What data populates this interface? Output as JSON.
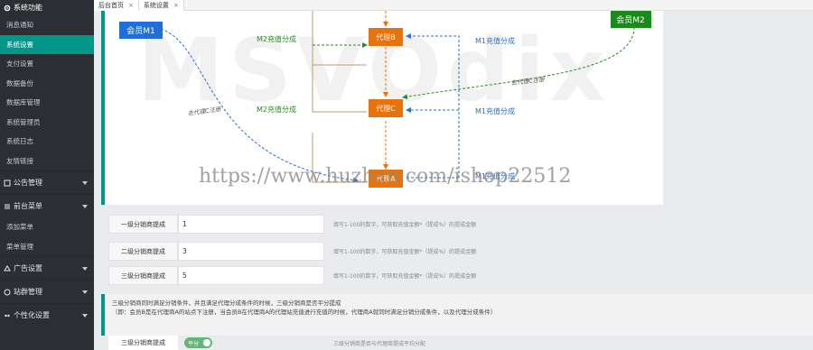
{
  "sidebar": {
    "header": "系统功能",
    "items": [
      {
        "label": "消息通知"
      },
      {
        "label": "系统设置"
      },
      {
        "label": "支付设置"
      },
      {
        "label": "数据备份"
      },
      {
        "label": "数据库管理"
      },
      {
        "label": "系统管理员"
      },
      {
        "label": "系统日志"
      },
      {
        "label": "友情链接"
      }
    ],
    "groups": [
      {
        "label": "公告管理"
      },
      {
        "label": "前台菜单"
      }
    ],
    "group_items": [
      {
        "label": "添加菜单"
      },
      {
        "label": "菜单管理"
      }
    ],
    "groups2": [
      {
        "label": "广告设置"
      },
      {
        "label": "站群管理"
      },
      {
        "label": "个性化设置"
      }
    ]
  },
  "tabs": [
    {
      "label": "后台首页"
    },
    {
      "label": "系统设置"
    }
  ],
  "diagram": {
    "watermark": "MSVOdix",
    "nodes": {
      "member_m1": "会员M1",
      "member_m2": "会员M2",
      "agent_b": "代理B",
      "agent_c": "代理C",
      "agent_a": "代理A"
    },
    "labels": {
      "m2_to_b": "M2充值分成",
      "m1_to_b": "M1充值分成",
      "m2_to_c": "M2充值分成",
      "m1_to_c": "M1充值分成",
      "m1_to_a": "M1充值分成",
      "m1_reg": "去代理C注册",
      "m2_reg": "去代理C注册"
    },
    "overlay_url": "https://www.huzhan.com/ishop22512"
  },
  "form": {
    "rows": [
      {
        "label": "一级分销商提成",
        "value": "1",
        "help": "填写1-100的数字，可获取充值金额*（提成%）的提成金额"
      },
      {
        "label": "二级分销商提成",
        "value": "3",
        "help": "填写1-100的数字，可获取充值金额*（提成%）的提成金额"
      },
      {
        "label": "三级分销商提成",
        "value": "5",
        "help": "填写1-100的数字，可获取充值金额*（提成%）的提成金额"
      }
    ]
  },
  "note": {
    "line1": "三级分销商同时满足分销条件，并且满足代理分成条件的时候，三级分销商是否平分提成",
    "line2": "（即：会员B是在代理商A的站点下注册，当会员B在代理商A的代理站充值进行充值的时候，代理商A就同时满足分销分成条件，以及代理分成条件）"
  },
  "switch_row": {
    "label": "三级分销商提成",
    "switch_text": "平分",
    "help": "三级分销商是否与代理商提成平均分配"
  },
  "colors": {
    "accent": "#009688",
    "sidebar_bg": "#2b2e33",
    "blue_node": "#1e6fd9",
    "green_node": "#1a8a1a",
    "orange_node": "#e8720c"
  }
}
